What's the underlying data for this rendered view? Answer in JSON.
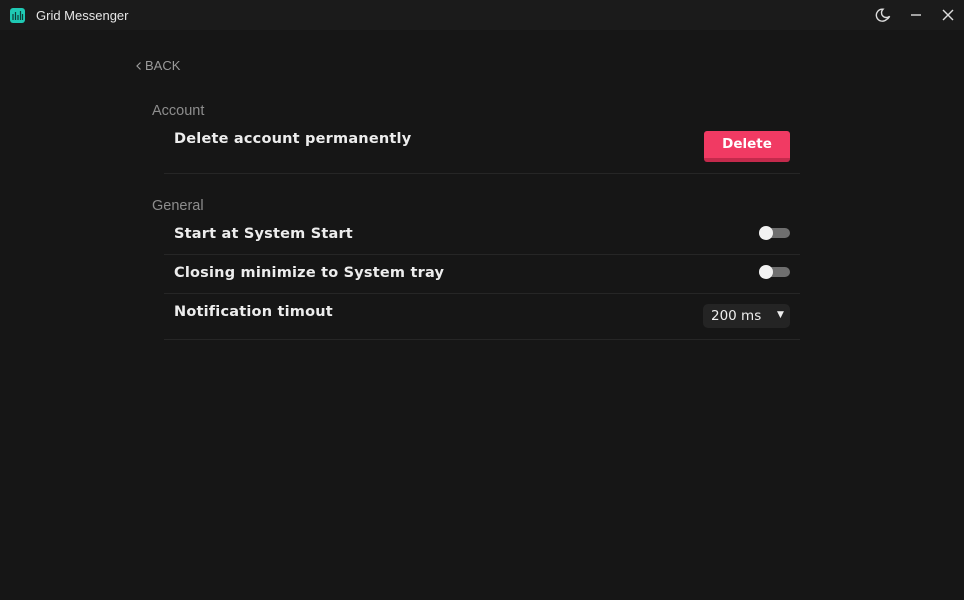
{
  "window": {
    "title": "Grid Messenger",
    "logo_icon": "grid-messenger-logo",
    "accent_color": "#1fc9b4"
  },
  "titlebar_controls": {
    "theme_icon": "moon-icon",
    "minimize_icon": "minimize-icon",
    "close_icon": "close-icon"
  },
  "nav": {
    "back_label": "BACK"
  },
  "sections": {
    "account": {
      "title": "Account",
      "delete_row_label": "Delete account permanently",
      "delete_button_label": "Delete",
      "delete_button_color": "#f13a63"
    },
    "general": {
      "title": "General",
      "start_at_system_start": {
        "label": "Start at System Start",
        "enabled": false
      },
      "closing_minimize": {
        "label": "Closing minimize to System tray",
        "enabled": false
      },
      "notification_timeout": {
        "label": "Notification timout",
        "value": "200 ms"
      }
    }
  }
}
